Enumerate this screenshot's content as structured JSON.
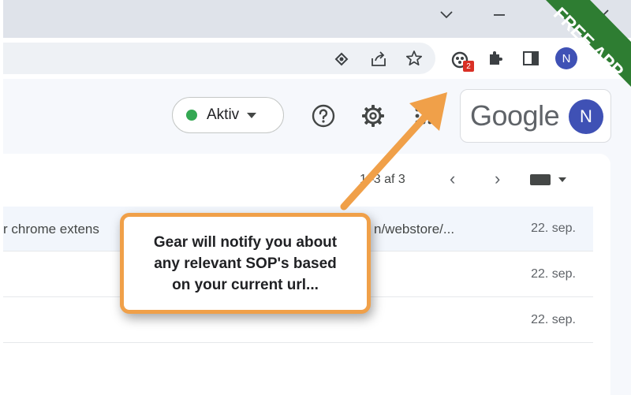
{
  "browser": {
    "extension_badge": "2",
    "profile_initial": "N"
  },
  "gmail": {
    "status_label": "Aktiv",
    "account_logo": "Google",
    "account_initial": "N",
    "pager_text": "1–3 af 3",
    "rows": [
      {
        "text": "r chrome extens",
        "link": "n/webstore/...",
        "date": "22. sep."
      },
      {
        "text": "",
        "link": "",
        "date": "22. sep."
      },
      {
        "text": "",
        "link": "",
        "date": "22. sep."
      }
    ]
  },
  "callout": {
    "line1": "Gear will notify you about",
    "line2": "any relevant SOP's based",
    "line3": "on your current url..."
  },
  "ribbon": {
    "label": "FREE APP",
    "color": "#2e7d32"
  },
  "colors": {
    "callout_border": "#f0a049",
    "arrow": "#f0a049",
    "status_dot": "#34a853",
    "avatar": "#3f51b5"
  },
  "icons": [
    "chevron-down-icon",
    "minimize-icon",
    "close-icon",
    "lens-icon",
    "share-icon",
    "star-icon",
    "extension-gear-icon",
    "puzzle-icon",
    "side-panel-icon",
    "help-icon",
    "settings-icon",
    "apps-grid-icon",
    "chevron-left-icon",
    "chevron-right-icon",
    "keyboard-icon"
  ]
}
